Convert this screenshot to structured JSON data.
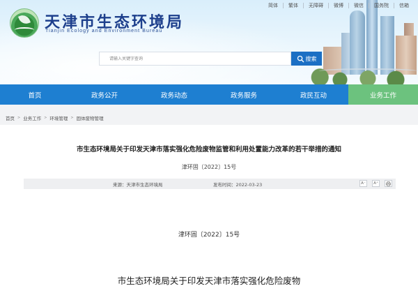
{
  "header": {
    "site_title": "天津市生态环境局",
    "site_subtitle": "Tianjin Ecology and Environment Bureau",
    "top_links": [
      "简体",
      "繁体",
      "无障碍",
      "微博",
      "微信",
      "国务院",
      "信箱"
    ]
  },
  "search": {
    "placeholder": "请输入关键字查询",
    "button_label": "搜索"
  },
  "nav": {
    "items": [
      {
        "label": "首页",
        "active": false
      },
      {
        "label": "政务公开",
        "active": false
      },
      {
        "label": "政务动态",
        "active": false
      },
      {
        "label": "政务服务",
        "active": false
      },
      {
        "label": "政民互动",
        "active": false
      },
      {
        "label": "业务工作",
        "active": true
      }
    ]
  },
  "breadcrumb": [
    "首页",
    "业务工作",
    "环境管理",
    "固体废物管理"
  ],
  "article": {
    "title": "市生态环境局关于印发天津市落实强化危险废物监管和利用处置能力改革的若干举措的通知",
    "doc_number": "津环固〔2022〕15号",
    "source": "来源：天津市生态环境局",
    "published": "发布时间：2022-03-23",
    "tools": [
      "A⁻",
      "A⁺",
      "print-icon"
    ],
    "body_doc_number": "津环固〔2022〕15号",
    "body_heading": "市生态环境局关于印发天津市落实强化危险废物"
  },
  "colors": {
    "nav_bg": "#1e7fd1",
    "nav_active": "#6cc27e",
    "title_blue": "#1d3f8c",
    "search_button": "#1b6fc4"
  }
}
